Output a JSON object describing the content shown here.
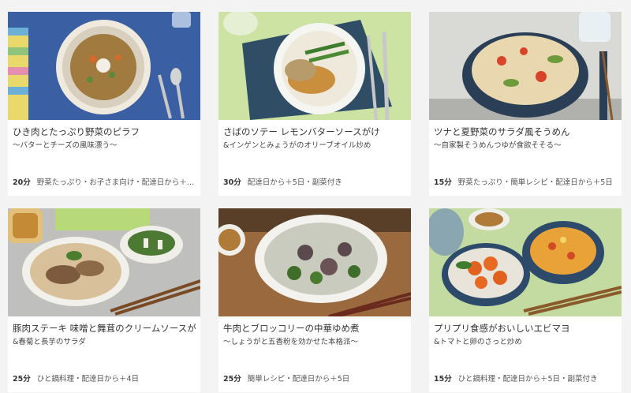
{
  "recipes": [
    {
      "title": "ひき肉とたっぷり野菜のピラフ",
      "subtitle": "～バターとチーズの風味漂う～",
      "time": "20分",
      "tags": "野菜たっぷり・お子さま向け・配達日から＋…",
      "photo_icon": "pilaf-photo"
    },
    {
      "title": "さばのソテー レモンバターソースがけ",
      "subtitle": "&インゲンとみょうがのオリーブオイル炒め",
      "time": "30分",
      "tags": "配達日から＋5日・副菜付き",
      "photo_icon": "mackerel-photo"
    },
    {
      "title": "ツナと夏野菜のサラダ風そうめん",
      "subtitle": "～自家製そうめんつゆが食欲そそる～",
      "time": "15分",
      "tags": "野菜たっぷり・簡単レシピ・配達日から＋5日",
      "photo_icon": "somen-photo"
    },
    {
      "title": "豚肉ステーキ 味噌と舞茸のクリームソースがけ",
      "subtitle": "&春菊と長芋のサラダ",
      "time": "25分",
      "tags": "ひと鍋料理・配達日から＋4日",
      "photo_icon": "pork-steak-photo"
    },
    {
      "title": "牛肉とブロッコリーの中華ゆめ煮",
      "subtitle": "～しょうがと五香粉を効かせた本格派～",
      "time": "25分",
      "tags": "簡単レシピ・配達日から＋5日",
      "photo_icon": "beef-broccoli-photo"
    },
    {
      "title": "プリプリ食感がおいしいエビマヨ",
      "subtitle": "&トマトと卵のさっと炒め",
      "time": "15分",
      "tags": "ひと鍋料理・配達日から＋5日・副菜付き",
      "photo_icon": "shrimp-mayo-photo"
    }
  ]
}
